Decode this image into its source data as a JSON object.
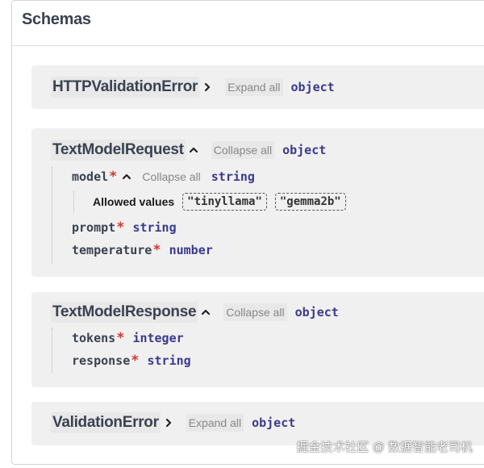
{
  "section": {
    "title": "Schemas"
  },
  "models": [
    {
      "name": "HTTPValidationError",
      "toggle": "Expand all",
      "type": "object"
    },
    {
      "name": "TextModelRequest",
      "toggle": "Collapse all",
      "type": "object",
      "props": [
        {
          "name": "model",
          "required": "*",
          "toggle": "Collapse all",
          "type": "string",
          "allowed_label": "Allowed values",
          "allowed": [
            "\"tinyllama\"",
            "\"gemma2b\""
          ]
        },
        {
          "name": "prompt",
          "required": "*",
          "type": "string"
        },
        {
          "name": "temperature",
          "required": "*",
          "type": "number"
        }
      ]
    },
    {
      "name": "TextModelResponse",
      "toggle": "Collapse all",
      "type": "object",
      "props": [
        {
          "name": "tokens",
          "required": "*",
          "type": "integer"
        },
        {
          "name": "response",
          "required": "*",
          "type": "string"
        }
      ]
    },
    {
      "name": "ValidationError",
      "toggle": "Expand all",
      "type": "object"
    }
  ],
  "watermark": "掘金技术社区 @ 数据智能老司机"
}
